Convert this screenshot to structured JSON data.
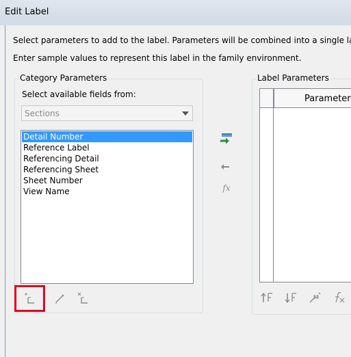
{
  "window": {
    "title": "Edit Label"
  },
  "intro": {
    "line1": "Select parameters to add to the label.  Parameters will be combined into a single label.",
    "line2": "Enter sample values to represent this label in the family environment."
  },
  "category_parameters": {
    "group_title": "Category Parameters",
    "fields_label": "Select available fields from:",
    "dropdown": {
      "selected": "Sections"
    },
    "items": [
      {
        "label": "Detail Number",
        "selected": true
      },
      {
        "label": "Reference Label",
        "selected": false
      },
      {
        "label": "Referencing Detail",
        "selected": false
      },
      {
        "label": "Referencing Sheet",
        "selected": false
      },
      {
        "label": "Sheet Number",
        "selected": false
      },
      {
        "label": "View Name",
        "selected": false
      }
    ],
    "buttons": {
      "new_parameter_icon": "new-parameter-icon",
      "edit_parameter_icon": "edit-parameter-icon",
      "delete_parameter_icon": "delete-parameter-icon"
    }
  },
  "transfer_buttons": {
    "add_icon": "add-to-label-icon",
    "remove_icon": "remove-from-label-icon",
    "formula_icon": "formula-icon",
    "formula_glyph": "fx"
  },
  "label_parameters": {
    "group_title": "Label Parameters",
    "columns": [
      "Parameter"
    ],
    "buttons": {
      "move_up_icon": "move-up-icon",
      "move_down_icon": "move-down-icon",
      "unit_format_icon": "unit-format-icon",
      "formula_icon": "formula-icon"
    }
  },
  "colors": {
    "selection": "#3399ff",
    "highlight_border": "#e0001b",
    "accent_add": "#2a8c3c"
  }
}
